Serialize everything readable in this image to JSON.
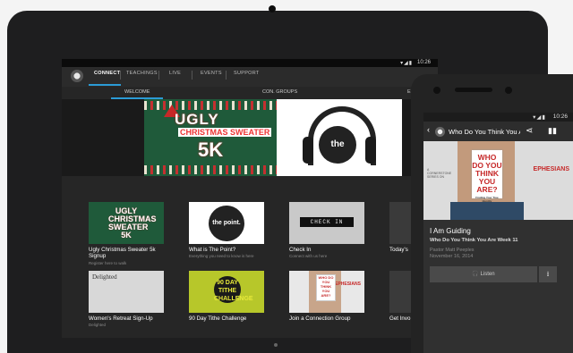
{
  "tablet": {
    "status": {
      "signal": "▾◢▮",
      "time": "10:26"
    },
    "nav": {
      "tabs": [
        "CONNECT",
        "TEACHINGS",
        "LIVE",
        "EVENTS",
        "SUPPORT"
      ]
    },
    "subtabs": [
      "WELCOME",
      "CON. GROUPS",
      "E"
    ],
    "hero": {
      "sweater_line1": "UGLY",
      "sweater_line2": "CHRISTMAS SWEATER",
      "sweater_line3": "5K",
      "point_label": "the point."
    },
    "cards": [
      {
        "title": "Ugly Christmas Sweater 5k Signup",
        "subtitle": "Register here to walk",
        "thumb_text": "UGLY CHRISTMAS SWEATER 5K"
      },
      {
        "title": "What is The Point?",
        "subtitle": "Everything you need to know is here",
        "thumb_text": "the point."
      },
      {
        "title": "Check In",
        "subtitle": "Connect with us here",
        "thumb_text": "CHECK IN"
      },
      {
        "title": "Today's",
        "subtitle": "",
        "thumb_text": ""
      },
      {
        "title": "Women's Retreat Sign-Up",
        "subtitle": "Delighted",
        "thumb_text": "Delighted"
      },
      {
        "title": "90 Day Tithe Challenge",
        "subtitle": "",
        "thumb_text": "90 DAY TITHE CHALLENGE"
      },
      {
        "title": "Join a Connection Group",
        "subtitle": "",
        "thumb_text": "WHO DO YOU THINK YOU ARE?",
        "thumb_side": "EPHESIANS"
      },
      {
        "title": "Get Invo",
        "subtitle": "",
        "thumb_text": ""
      }
    ]
  },
  "phone": {
    "status": {
      "signal": "▾◢▮",
      "time": "10:26"
    },
    "back": "‹",
    "title": "Who Do You Think You Are",
    "share_icon": "⋖",
    "chart_icon": "▮▮",
    "image": {
      "card": "WHO DO YOU THINK YOU ARE?",
      "card_small": "Finding Your True Identity",
      "side": "EPHESIANS",
      "corner": "A CORNERSTONE SERIES ON"
    },
    "heading": "I Am Guiding",
    "series": "Who Do You Think You Are Week 11",
    "speaker": "Pastor Matt Peeples",
    "date": "November 16, 2014",
    "listen": "🎧 Listen",
    "download": "⭳"
  }
}
